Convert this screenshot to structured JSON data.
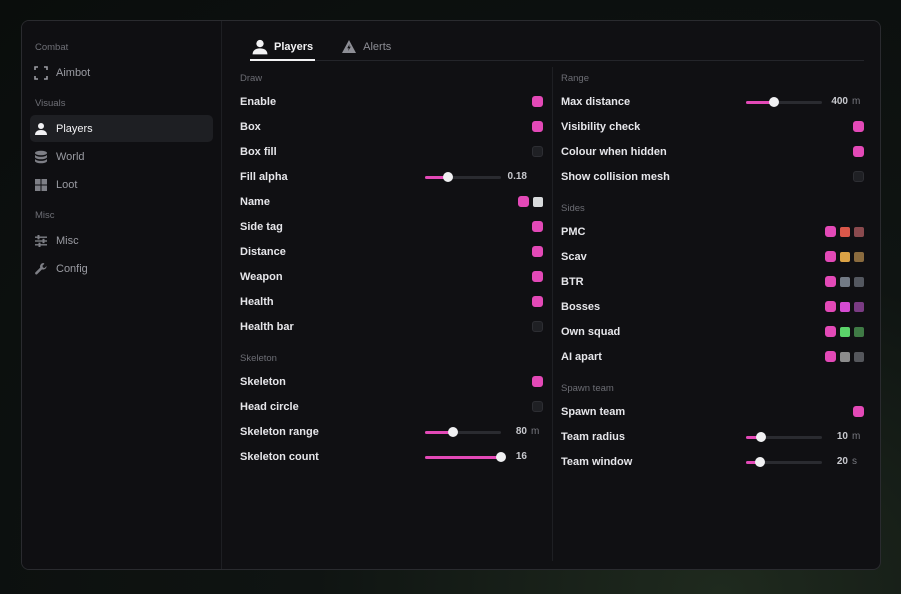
{
  "sidebar": {
    "sections": [
      {
        "title": "Combat",
        "items": [
          {
            "label": "Aimbot",
            "icon": "crosshair-frame-icon"
          }
        ]
      },
      {
        "title": "Visuals",
        "items": [
          {
            "label": "Players",
            "icon": "user-icon",
            "active": true
          },
          {
            "label": "World",
            "icon": "database-icon"
          },
          {
            "label": "Loot",
            "icon": "grid-icon"
          }
        ]
      },
      {
        "title": "Misc",
        "items": [
          {
            "label": "Misc",
            "icon": "sliders-icon"
          },
          {
            "label": "Config",
            "icon": "wrench-icon"
          }
        ]
      }
    ]
  },
  "tabs": [
    {
      "label": "Players",
      "icon": "user-icon",
      "active": true
    },
    {
      "label": "Alerts",
      "icon": "alert-triangle-icon",
      "active": false
    }
  ],
  "colors": {
    "accent": "#e349b7",
    "off": "#1f2024"
  },
  "left": {
    "draw": {
      "title": "Draw",
      "rows": [
        {
          "label": "Enable",
          "checked": true
        },
        {
          "label": "Box",
          "checked": true
        },
        {
          "label": "Box fill",
          "checked": false
        },
        {
          "label": "Fill alpha",
          "slider": 0.3,
          "value": "0.18",
          "unit": ""
        },
        {
          "label": "Name",
          "checked": true,
          "swatches": [
            "#d8dadc"
          ]
        },
        {
          "label": "Side tag",
          "checked": true
        },
        {
          "label": "Distance",
          "checked": true
        },
        {
          "label": "Weapon",
          "checked": true
        },
        {
          "label": "Health",
          "checked": true
        },
        {
          "label": "Health bar",
          "checked": false
        }
      ]
    },
    "skeleton": {
      "title": "Skeleton",
      "rows": [
        {
          "label": "Skeleton",
          "checked": true
        },
        {
          "label": "Head circle",
          "checked": false
        },
        {
          "label": "Skeleton range",
          "slider": 0.37,
          "value": "80",
          "unit": "m"
        },
        {
          "label": "Skeleton count",
          "slider": 1.0,
          "value": "16",
          "unit": ""
        }
      ]
    }
  },
  "right": {
    "range": {
      "title": "Range",
      "rows": [
        {
          "label": "Max distance",
          "slider": 0.37,
          "value": "400",
          "unit": "m"
        },
        {
          "label": "Visibility check",
          "checked": true
        },
        {
          "label": "Colour when hidden",
          "checked": true
        },
        {
          "label": "Show collision mesh",
          "checked": false
        }
      ]
    },
    "sides": {
      "title": "Sides",
      "rows": [
        {
          "label": "PMC",
          "checked": true,
          "swatches": [
            "#d9574a",
            "#8a4a4e"
          ]
        },
        {
          "label": "Scav",
          "checked": true,
          "swatches": [
            "#dba245",
            "#8a6b3e"
          ]
        },
        {
          "label": "BTR",
          "checked": true,
          "swatches": [
            "#727a85",
            "#545860"
          ]
        },
        {
          "label": "Bosses",
          "checked": true,
          "swatches": [
            "#d54bd2",
            "#7a3b83"
          ]
        },
        {
          "label": "Own squad",
          "checked": true,
          "swatches": [
            "#5bd36a",
            "#3f7a45"
          ]
        },
        {
          "label": "AI apart",
          "checked": true,
          "swatches": [
            "#8c8c8c",
            "#55575c"
          ]
        }
      ]
    },
    "spawn": {
      "title": "Spawn team",
      "rows": [
        {
          "label": "Spawn team",
          "checked": true
        },
        {
          "label": "Team radius",
          "slider": 0.2,
          "value": "10",
          "unit": "m"
        },
        {
          "label": "Team window",
          "slider": 0.18,
          "value": "20",
          "unit": "s"
        }
      ]
    }
  }
}
